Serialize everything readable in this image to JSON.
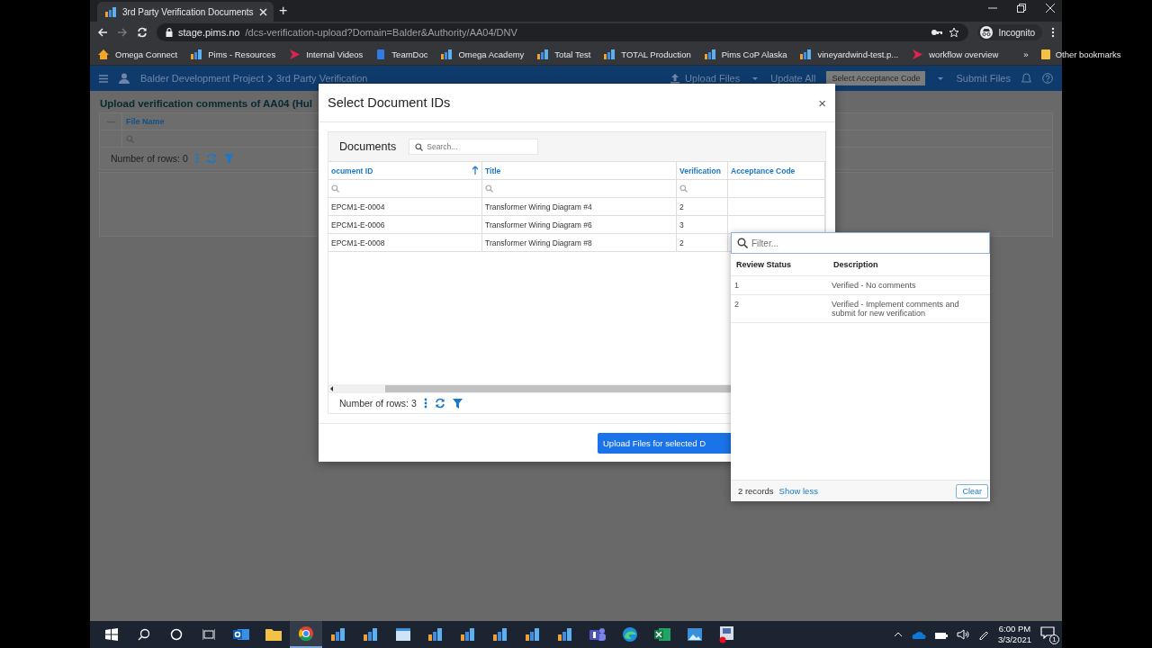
{
  "browser": {
    "tabs": [
      {
        "title": "3rd Party Verification Documents",
        "selected": true
      }
    ],
    "new_tab": "+",
    "address": {
      "host": "stage.pims.no",
      "path": "/dcs-verification-upload?Domain=Balder&Authority/AA04/DNV"
    },
    "profile": "Incognito",
    "bookmarks": [
      {
        "label": "Omega Connect",
        "kind": "home"
      },
      {
        "label": "Pims - Resources",
        "kind": "pims"
      },
      {
        "label": "Internal Videos",
        "kind": "video"
      },
      {
        "label": "TeamDoc",
        "kind": "doc"
      },
      {
        "label": "Omega Academy",
        "kind": "pims"
      },
      {
        "label": "Total Test",
        "kind": "pims"
      },
      {
        "label": "TOTAL Production",
        "kind": "pims"
      },
      {
        "label": "Pims CoP Alaska",
        "kind": "pims"
      },
      {
        "label": "vineyardwind-test.p...",
        "kind": "pims"
      },
      {
        "label": "workflow overview",
        "kind": "video"
      }
    ],
    "more": "»",
    "other_bookmarks": "Other bookmarks"
  },
  "app": {
    "breadcrumb": [
      "Balder Development Project",
      "3rd Party Verification"
    ],
    "actions": [
      {
        "label": "Upload Files",
        "kind": "upload"
      },
      {
        "label": "Update All",
        "kind": "link"
      },
      {
        "label": "Select Acceptance Code",
        "kind": "select"
      },
      {
        "label": "Submit Files",
        "kind": "link"
      }
    ],
    "page_title": "Upload verification comments of AA04 (Hul",
    "table": {
      "columns": [
        "File Name"
      ],
      "row_count": "Number of rows: 0"
    }
  },
  "dialog": {
    "title": "Select Document IDs",
    "close": "×",
    "panel_title": "Documents",
    "search_placeholder": "Search...",
    "columns": [
      {
        "label": "ocument ID",
        "sorted": true,
        "filter": true
      },
      {
        "label": "Title",
        "sorted": false,
        "filter": true
      },
      {
        "label": "Verification",
        "sorted": false,
        "filter": true
      },
      {
        "label": "Acceptance Code",
        "sorted": false,
        "filter": false
      }
    ],
    "rows": [
      {
        "document_id": "EPCM1-E-0004",
        "title": "Transformer Wiring Diagram #4",
        "verification": "2"
      },
      {
        "document_id": "EPCM1-E-0006",
        "title": "Transformer Wiring Diagram #6",
        "verification": "3"
      },
      {
        "document_id": "EPCM1-E-0008",
        "title": "Transformer Wiring Diagram #8",
        "verification": "2"
      }
    ],
    "row_count": "Number of rows: 3",
    "submit": "Upload Files for selected D"
  },
  "dropdown": {
    "placeholder": "Filter...",
    "columns": [
      "Review Status",
      "Description"
    ],
    "rows": [
      {
        "status": "1",
        "description": "Verified - No comments"
      },
      {
        "status": "2",
        "description": "Verified - Implement comments and submit for new verification"
      }
    ],
    "records": "2 records",
    "toggle": "Show less",
    "clear": "Clear"
  },
  "taskbar": {
    "apps": [
      {
        "kind": "mail",
        "selected": false
      },
      {
        "kind": "folder",
        "selected": false
      },
      {
        "kind": "browser",
        "selected": true
      },
      {
        "kind": "pims",
        "selected": false
      },
      {
        "kind": "pims",
        "selected": false
      },
      {
        "kind": "window",
        "selected": false
      },
      {
        "kind": "pims",
        "selected": false
      },
      {
        "kind": "pims",
        "selected": false
      },
      {
        "kind": "pims",
        "selected": false
      },
      {
        "kind": "pims",
        "selected": false
      },
      {
        "kind": "pims",
        "selected": false
      },
      {
        "kind": "teams",
        "selected": false
      },
      {
        "kind": "edge",
        "selected": false
      },
      {
        "kind": "sheet",
        "selected": false
      },
      {
        "kind": "photo",
        "selected": false
      },
      {
        "kind": "record",
        "selected": false
      }
    ],
    "time": "6:00 PM",
    "date": "3/3/2021",
    "notifications": "1"
  }
}
